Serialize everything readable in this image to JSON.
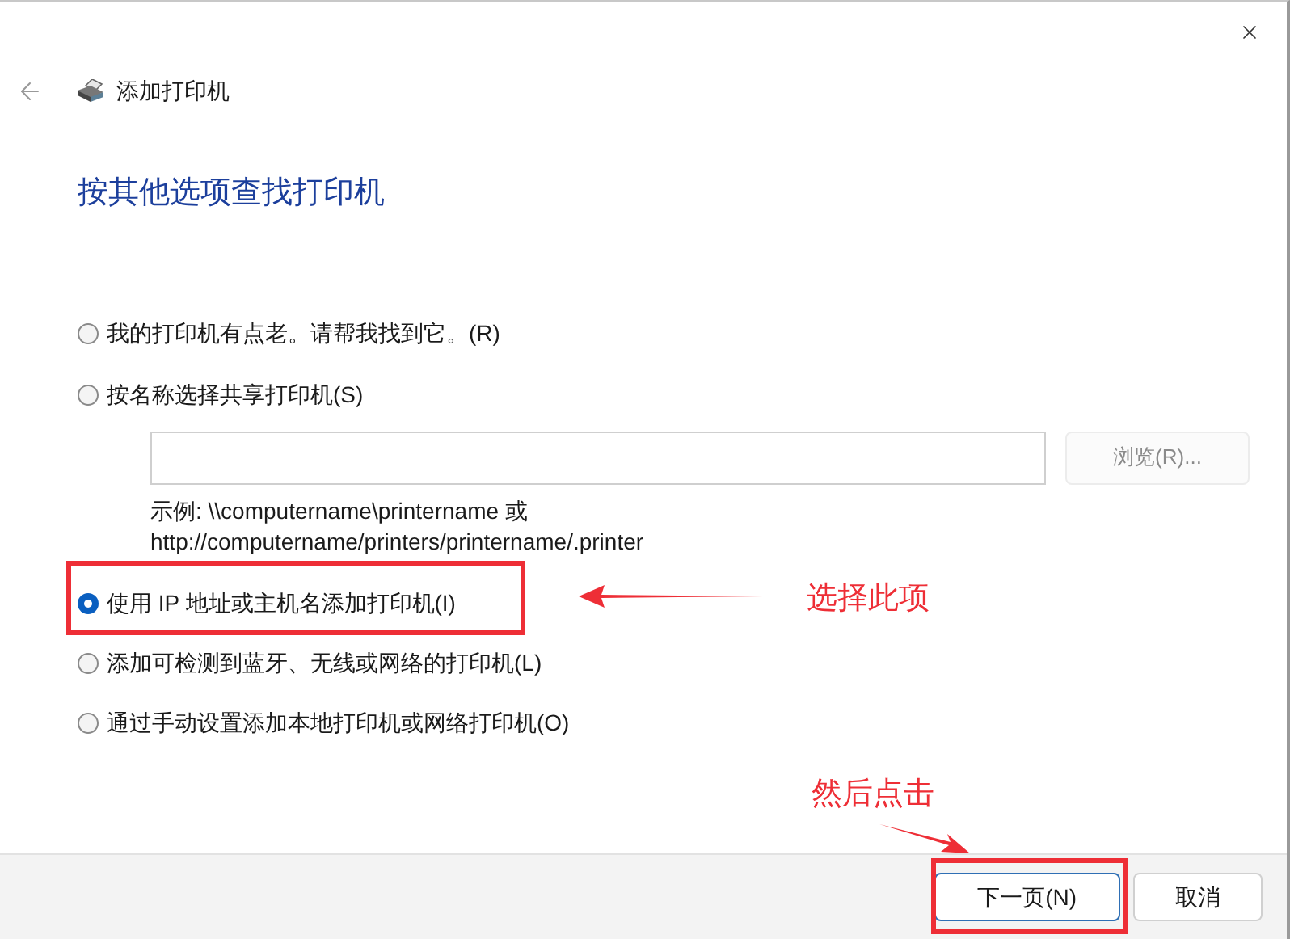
{
  "window": {
    "title": "添加打印机"
  },
  "heading": "按其他选项查找打印机",
  "options": [
    {
      "label": "我的打印机有点老。请帮我找到它。(R)",
      "selected": false
    },
    {
      "label": "按名称选择共享打印机(S)",
      "selected": false
    },
    {
      "label": "使用 IP 地址或主机名添加打印机(I)",
      "selected": true
    },
    {
      "label": "添加可检测到蓝牙、无线或网络的打印机(L)",
      "selected": false
    },
    {
      "label": "通过手动设置添加本地打印机或网络打印机(O)",
      "selected": false
    }
  ],
  "share_name": {
    "browse_button": {
      "label": "浏览(R)...",
      "disabled": true
    },
    "example_lines": [
      "示例: \\\\computername\\printername 或",
      "http://computername/printers/printername/.printer"
    ]
  },
  "buttons": [
    {
      "label": "下一页(N)",
      "default": true
    },
    {
      "label": "取消",
      "default": false
    }
  ],
  "annotations": [
    {
      "text": "选择此项"
    },
    {
      "text": "然后点击"
    }
  ]
}
